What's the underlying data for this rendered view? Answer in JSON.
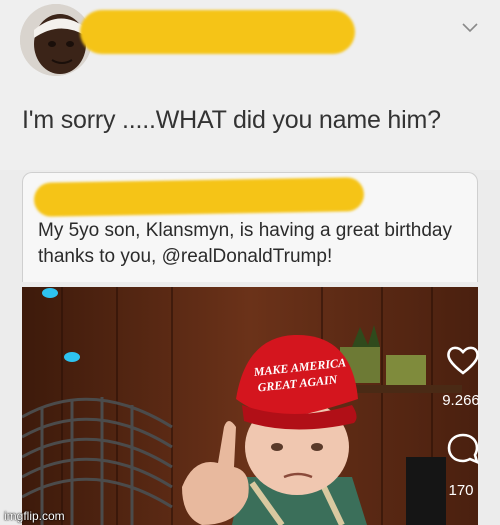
{
  "post": {
    "text": "I'm sorry .....WHAT did you name him?"
  },
  "quoted_post": {
    "text": "My 5yo son, Klansmyn, is having a great birthday thanks to you, @realDonaldTrump!"
  },
  "photo": {
    "hat_text_line1": "MAKE AMERICA",
    "hat_text_line2": "GREAT AGAIN"
  },
  "actions": {
    "like_count": "9.266",
    "comment_count": "170",
    "like_icon": "heart-icon",
    "comment_icon": "speech-bubble-icon"
  },
  "watermark": "imgflip.com",
  "colors": {
    "redaction": "#f5c417",
    "hat": "#d4151e"
  }
}
